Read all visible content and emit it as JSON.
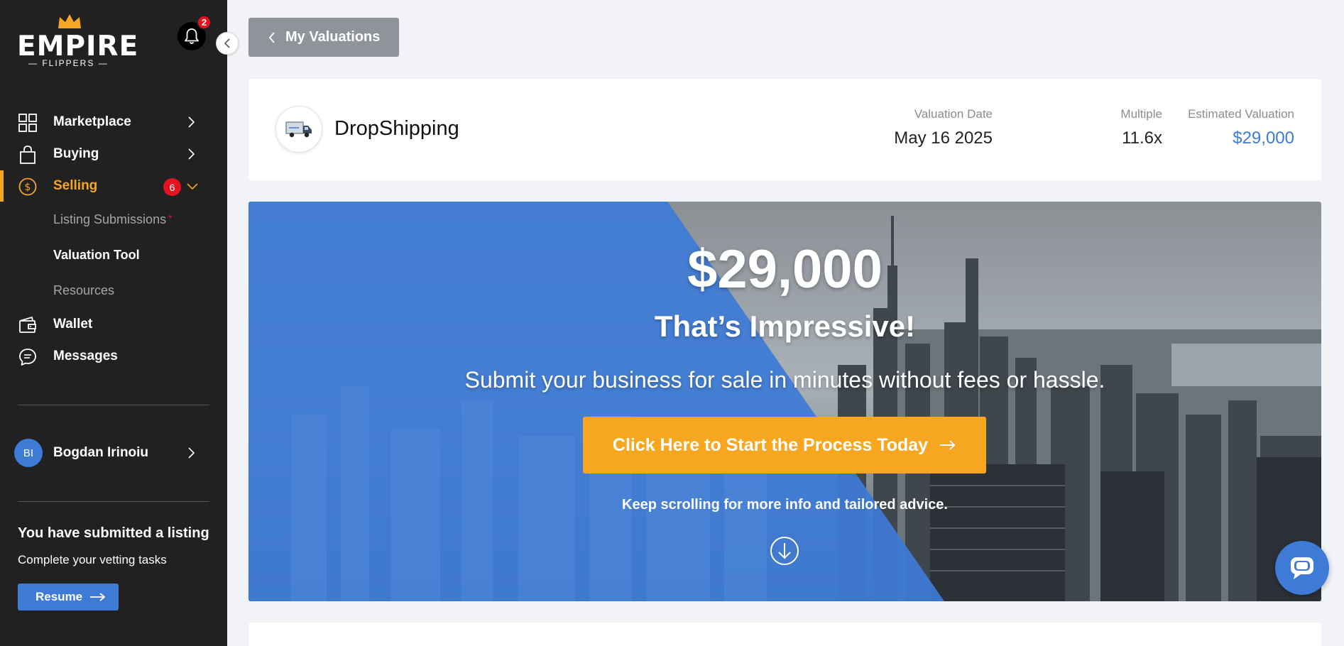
{
  "brand": {
    "logo_word": "EMPIRE",
    "logo_sub": "— FLIPPERS —"
  },
  "notifications": {
    "count": "2"
  },
  "sidebar": {
    "items": [
      {
        "label": "Marketplace",
        "icon": "grid-icon"
      },
      {
        "label": "Buying",
        "icon": "shopping-bag-icon"
      },
      {
        "label": "Selling",
        "icon": "dollar-circle-icon",
        "badge": "6"
      },
      {
        "label": "Wallet",
        "icon": "wallet-icon"
      },
      {
        "label": "Messages",
        "icon": "chat-bubble-icon"
      }
    ],
    "selling_sub": [
      {
        "label": "Listing Submissions",
        "required": "*"
      },
      {
        "label": "Valuation Tool"
      },
      {
        "label": "Resources"
      }
    ],
    "user": {
      "initials": "BI",
      "name": "Bogdan Irinoiu"
    },
    "promo": {
      "title": "You have submitted a listing",
      "subtitle": "Complete your vetting tasks",
      "button": "Resume"
    }
  },
  "main": {
    "back_label": "My Valuations",
    "business": {
      "name": "DropShipping",
      "icon": "delivery-truck-icon"
    },
    "stats": [
      {
        "label": "Valuation Date",
        "value": "May 16 2025"
      },
      {
        "label": "Multiple",
        "value": "11.6x"
      },
      {
        "label": "Estimated Valuation",
        "value": "$29,000"
      }
    ],
    "hero": {
      "amount": "$29,000",
      "title": "That’s Impressive!",
      "subtitle": "Submit your business for sale in minutes without fees or hassle.",
      "cta": "Click Here to Start the Process Today",
      "note": "Keep scrolling for more info and tailored advice."
    }
  },
  "colors": {
    "sidebar_bg": "#212121",
    "accent_orange": "#f5a623",
    "accent_blue": "#3d7bd6",
    "badge_red": "#e3141f"
  }
}
